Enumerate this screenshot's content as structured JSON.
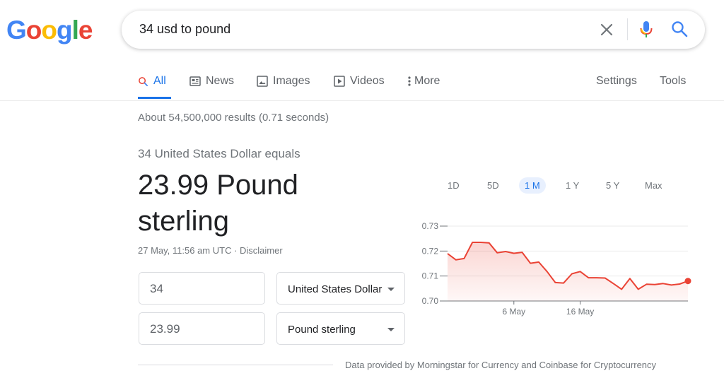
{
  "logo": {
    "letters": [
      "G",
      "o",
      "o",
      "g",
      "l",
      "e"
    ],
    "colors": [
      "#4285f4",
      "#ea4335",
      "#fbbc05",
      "#4285f4",
      "#34a853",
      "#ea4335"
    ]
  },
  "search": {
    "query": "34 usd to pound"
  },
  "icons": {
    "clear": "close-icon",
    "mic": "microphone-icon",
    "search": "search-icon"
  },
  "tabs": [
    {
      "label": "All",
      "icon": "search-icon",
      "active": true
    },
    {
      "label": "News",
      "icon": "news-icon"
    },
    {
      "label": "Images",
      "icon": "image-icon"
    },
    {
      "label": "Videos",
      "icon": "play-icon"
    },
    {
      "label": "More",
      "icon": "more-vertical-icon"
    }
  ],
  "tools": {
    "settings": "Settings",
    "tools": "Tools"
  },
  "result_stats": "About 54,500,000 results (0.71 seconds)",
  "converter": {
    "equals_label": "34 United States Dollar equals",
    "result_line1": "23.99 Pound",
    "result_line2": "sterling",
    "timestamp": "27 May, 11:56 am UTC · Disclaimer",
    "from_amount": "34",
    "from_currency": "United States Dollar",
    "to_amount": "23.99",
    "to_currency": "Pound sterling"
  },
  "ranges": [
    "1D",
    "5D",
    "1 M",
    "1 Y",
    "5 Y",
    "Max"
  ],
  "active_range": "1 M",
  "colors": {
    "accent": "#1a73e8",
    "line": "#ea4335",
    "fill": "#fce8e6"
  },
  "chart_data": {
    "type": "area",
    "y_ticks": [
      "0.73",
      "0.72",
      "0.71",
      "0.70"
    ],
    "ylim": [
      0.7,
      0.73
    ],
    "x_ticks": [
      {
        "label": "6 May",
        "index": 8
      },
      {
        "label": "16 May",
        "index": 16
      }
    ],
    "values": [
      0.719,
      0.7165,
      0.717,
      0.7235,
      0.7235,
      0.7233,
      0.7193,
      0.7198,
      0.7191,
      0.7195,
      0.7151,
      0.7156,
      0.7118,
      0.7074,
      0.7072,
      0.7109,
      0.7118,
      0.7093,
      0.7093,
      0.7092,
      0.707,
      0.7047,
      0.709,
      0.7047,
      0.7067,
      0.7066,
      0.707,
      0.7064,
      0.7068,
      0.708
    ],
    "grid": true
  },
  "attribution": "Data provided by Morningstar for Currency and Coinbase for Cryptocurrency"
}
